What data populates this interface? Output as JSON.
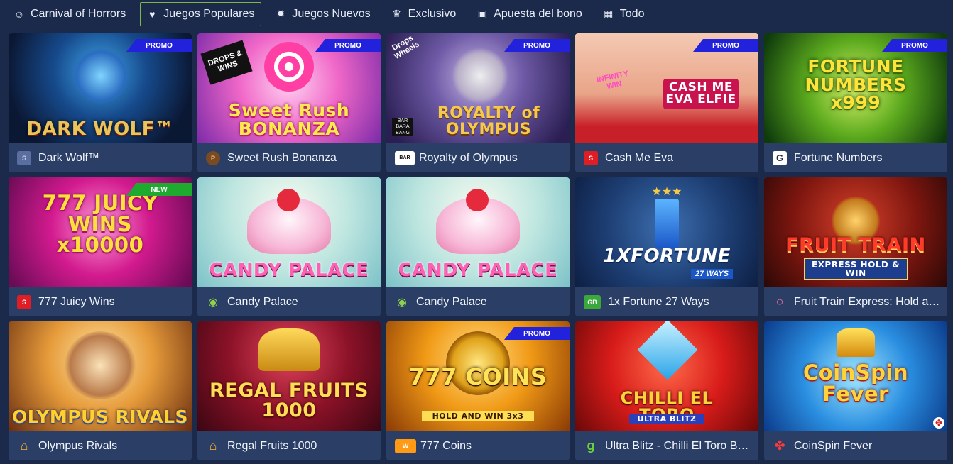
{
  "tabs": [
    {
      "label": "Carnival of Horrors",
      "icon": "mask-icon",
      "glyph": "☺"
    },
    {
      "label": "Juegos Populares",
      "icon": "hearts-icon",
      "glyph": "♥",
      "active": true
    },
    {
      "label": "Juegos Nuevos",
      "icon": "new-badge-icon",
      "glyph": "✹"
    },
    {
      "label": "Exclusivo",
      "icon": "crown-icon",
      "glyph": "♛"
    },
    {
      "label": "Apuesta del bono",
      "icon": "gift-icon",
      "glyph": "▣"
    },
    {
      "label": "Todo",
      "icon": "grid-icon",
      "glyph": "▦"
    }
  ],
  "games": [
    {
      "name": "Dark Wolf™",
      "art": "DARK WOLF™",
      "badge": "PROMO",
      "provider_icon": "spinomenal-icon",
      "pv": "S"
    },
    {
      "name": "Sweet Rush Bonanza",
      "art": "Sweet Rush BONANZA",
      "badge": "PROMO",
      "provider_icon": "pragmatic-play-icon",
      "pv": "P",
      "sticker": "DROPS & WINS"
    },
    {
      "name": "Royalty of Olympus",
      "art": "ROYALTY of OLYMPUS",
      "badge": "PROMO",
      "provider_icon": "barbarabang-icon",
      "pv": "BAR",
      "sticker": "Drops Wheels",
      "sub": "BAR BARA BANG"
    },
    {
      "name": "Cash Me Eva",
      "art": "CASH ME EVA ELFIE",
      "badge": "PROMO",
      "provider_icon": "s-provider-icon",
      "pv": "S",
      "sticker": "INFINITY WIN"
    },
    {
      "name": "Fortune Numbers",
      "art": "FORTUNE NUMBERS x999",
      "badge": "PROMO",
      "provider_icon": "g-provider-icon",
      "pv": "G"
    },
    {
      "name": "777 Juicy Wins",
      "art": "777 JUICY WINS x10000",
      "badge": "NEW",
      "provider_icon": "s-provider-icon",
      "pv": "S"
    },
    {
      "name": "Candy Palace",
      "art": "CANDY PALACE",
      "badge": "",
      "provider_icon": "eye-provider-icon",
      "pv": "◉"
    },
    {
      "name": "Candy Palace",
      "art": "CANDY PALACE",
      "badge": "",
      "provider_icon": "eye-provider-icon",
      "pv": "◉"
    },
    {
      "name": "1x Fortune 27 Ways",
      "art": "1XFORTUNE",
      "sub": "27 WAYS",
      "badge": "",
      "provider_icon": "gb-provider-icon",
      "pv": "GB"
    },
    {
      "name": "Fruit Train Express: Hold and Win",
      "art": "FRUIT TRAIN",
      "sub": "EXPRESS HOLD & WIN",
      "badge": "",
      "provider_icon": "ring-provider-icon",
      "pv": "○"
    },
    {
      "name": "Olympus Rivals",
      "art": "OLYMPUS RIVALS",
      "badge": "",
      "provider_icon": "temple-provider-icon",
      "pv": "⌂"
    },
    {
      "name": "Regal Fruits 1000",
      "art": "REGAL FRUITS 1000",
      "badge": "",
      "provider_icon": "temple-provider-icon",
      "pv": "⌂"
    },
    {
      "name": "777 Coins",
      "art": "777 COINS",
      "sub": "HOLD AND WIN 3x3",
      "badge": "PROMO",
      "provider_icon": "wow-provider-icon",
      "pv": "W"
    },
    {
      "name": "Ultra Blitz - Chilli El Toro Bu...",
      "art": "CHILLI EL TORO",
      "sub": "ULTRA BLITZ",
      "badge": "",
      "provider_icon": "leaf-provider-icon",
      "pv": "g"
    },
    {
      "name": "CoinSpin Fever",
      "art": "CoinSpin Fever",
      "badge": "",
      "provider_icon": "dots-provider-icon",
      "pv": "✤"
    }
  ],
  "colors": {
    "background": "#1b2a4a",
    "card": "#2b3f66",
    "promo": "#2222dd",
    "new": "#1eaa2e",
    "active_tab_border": "#7fb84a"
  }
}
